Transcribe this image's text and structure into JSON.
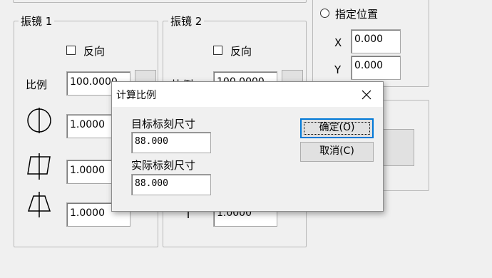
{
  "galvo1": {
    "title": "振镜 1",
    "reverse_label": "反向",
    "ratio_label": "比例",
    "ratio_value": "100.0000",
    "factor1": "1.0000",
    "factor2": "1.0000",
    "factor3": "1.0000"
  },
  "galvo2": {
    "title": "振镜 2",
    "reverse_label": "反向",
    "ratio_label": "比例",
    "ratio_value": "100.0000",
    "factor3": "1.0000"
  },
  "position": {
    "specify_label": "指定位置",
    "x_label": "X",
    "x_value": "0.000",
    "y_label": "Y",
    "y_value": "0.000"
  },
  "dialog": {
    "title": "计算比例",
    "target_label": "目标标刻尺寸",
    "target_value": "88.000",
    "actual_label": "实际标刻尺寸",
    "actual_value": "88.000",
    "ok_label": "确定(O)",
    "cancel_label": "取消(C)"
  },
  "icons": {
    "circle_line": "circle-with-vertical-line-icon",
    "parallelogram": "skewed-box-icon",
    "trapezoid": "trapezoid-icon",
    "close": "close-icon"
  }
}
